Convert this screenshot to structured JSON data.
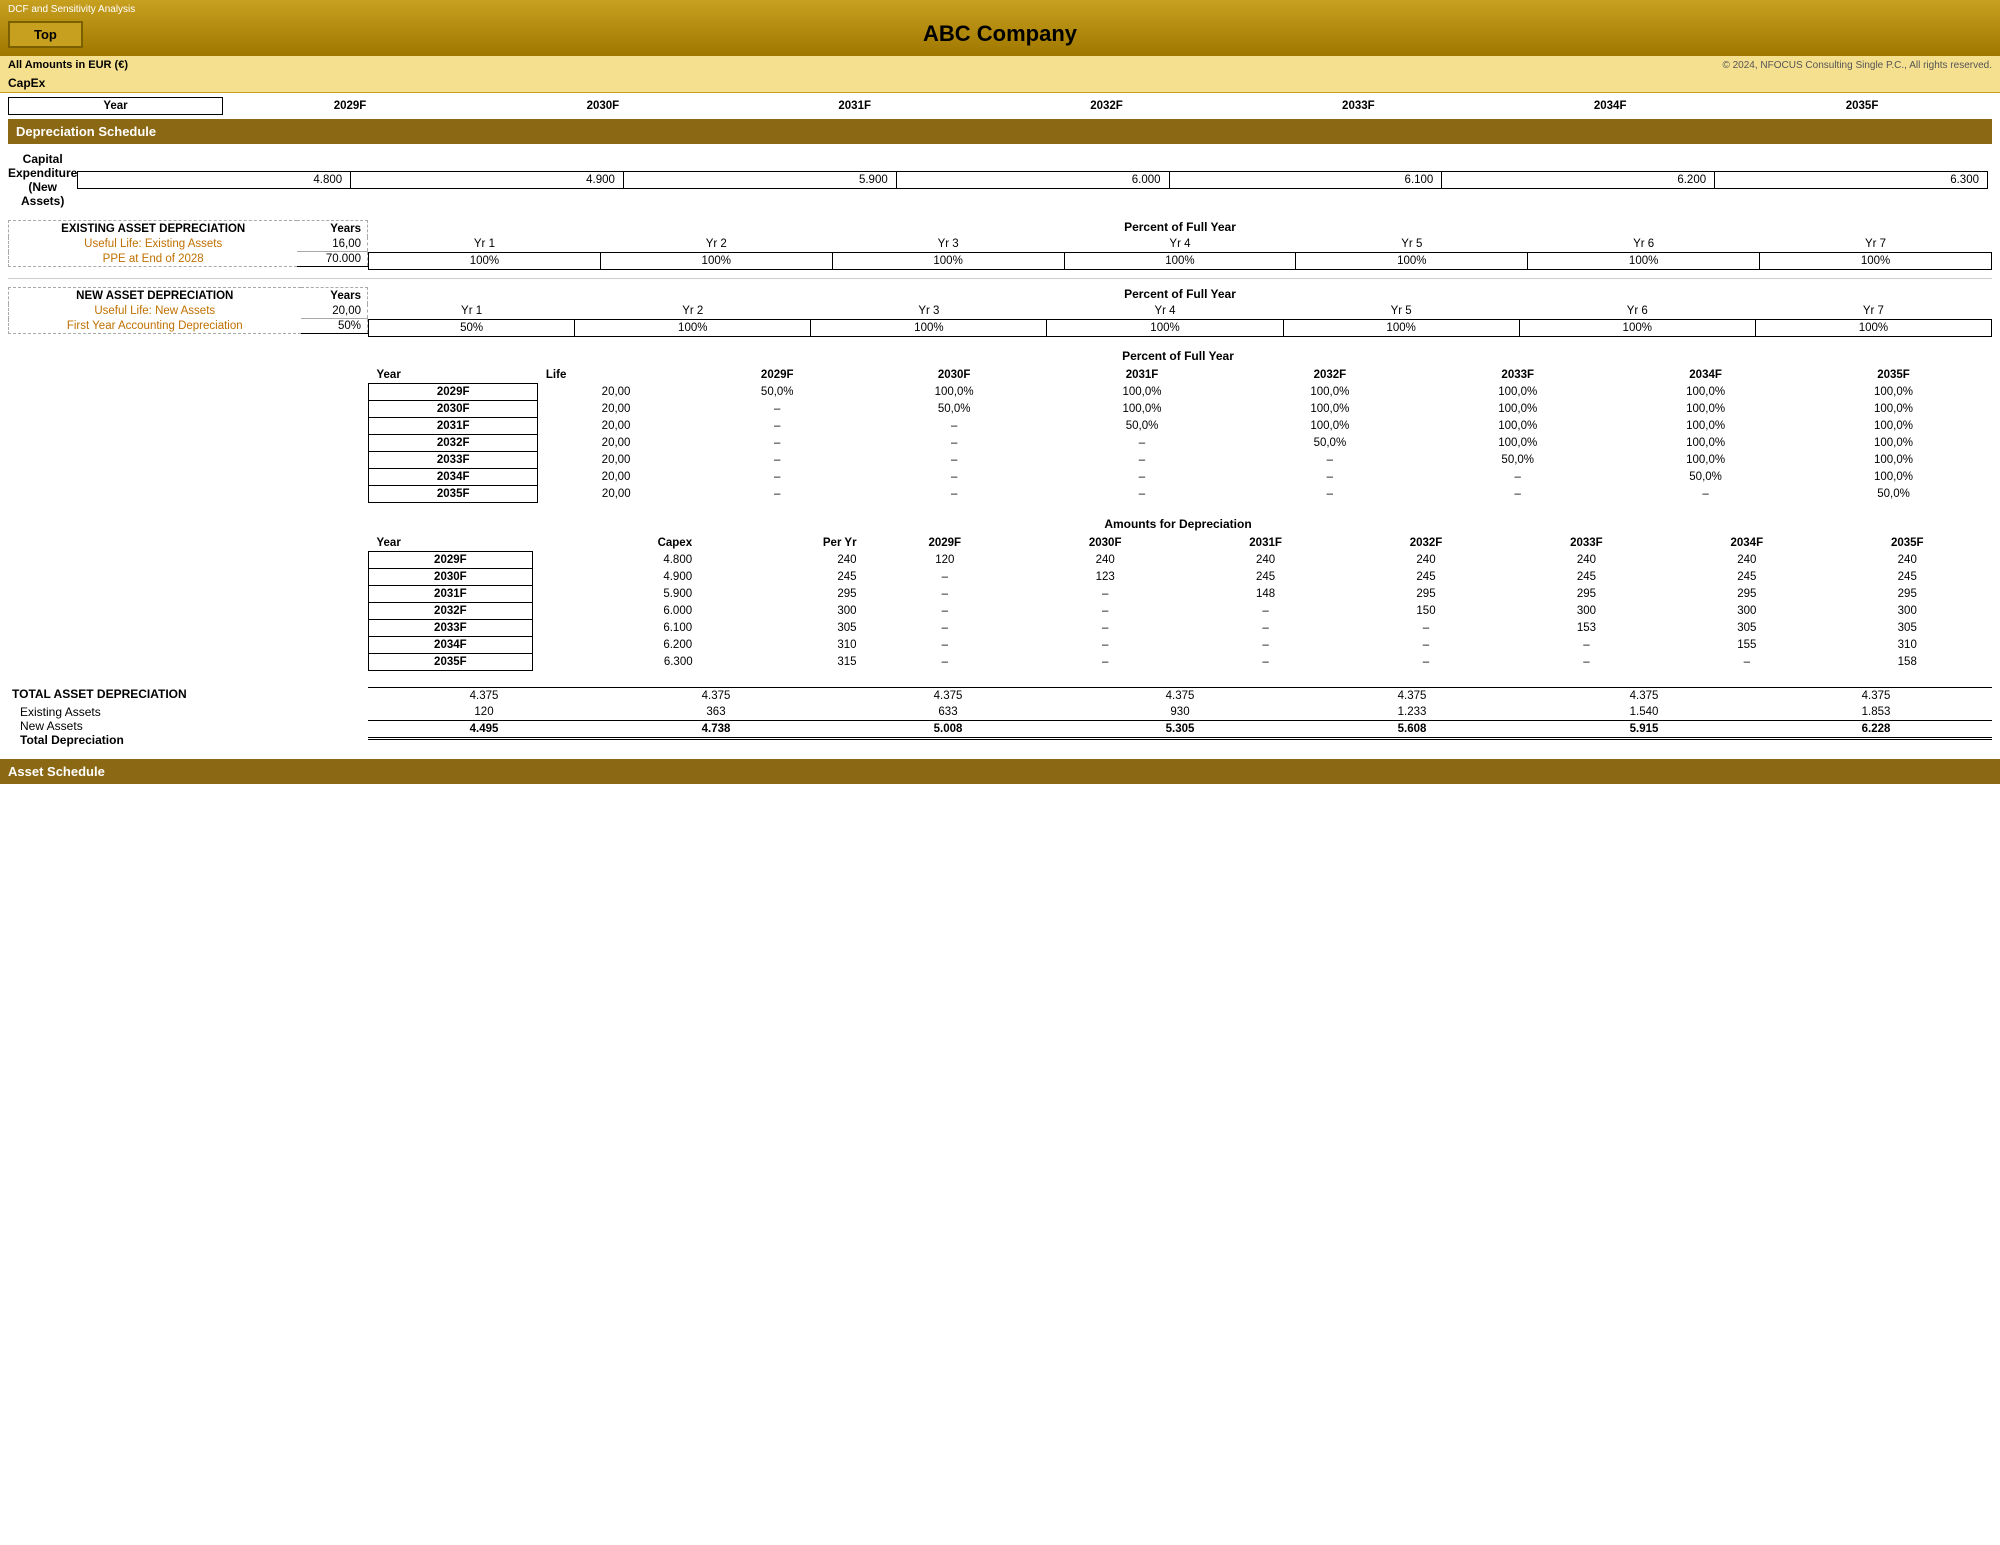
{
  "app": {
    "dcf_label": "DCF and Sensitivity Analysis",
    "title": "ABC Company",
    "top_button": "Top",
    "amounts_label": "All Amounts in  EUR (€)",
    "copyright": "© 2024, NFOCUS Consulting Single P.C., All rights reserved.",
    "capex_section": "CapEx"
  },
  "sections": {
    "depreciation_schedule": "Depreciation Schedule",
    "asset_schedule": "Asset Schedule"
  },
  "year_headers": [
    "Year",
    "2029F",
    "2030F",
    "2031F",
    "2032F",
    "2033F",
    "2034F",
    "2035F"
  ],
  "capital_expenditure": {
    "label": "Capital Expenditure  (New Assets)",
    "values": [
      "4.800",
      "4.900",
      "5.900",
      "6.000",
      "6.100",
      "6.200",
      "6.300"
    ]
  },
  "existing_asset": {
    "section_title": "EXISTING ASSET DEPRECIATION",
    "years_col": "Years",
    "rows": [
      {
        "label": "Useful Life: Existing Assets",
        "value": "16,00"
      },
      {
        "label": "PPE at End of 2028",
        "value": "70.000"
      }
    ],
    "pct_label": "Percent of Full Year",
    "yr_headers": [
      "Yr 1",
      "Yr 2",
      "Yr 3",
      "Yr 4",
      "Yr 5",
      "Yr 6",
      "Yr 7"
    ],
    "yr_values": [
      "100%",
      "100%",
      "100%",
      "100%",
      "100%",
      "100%",
      "100%"
    ]
  },
  "new_asset": {
    "section_title": "NEW ASSET DEPRECIATION",
    "years_col": "Years",
    "rows": [
      {
        "label": "Useful Life: New Assets",
        "value": "20,00"
      },
      {
        "label": "First Year Accounting Depreciation",
        "value": "50%"
      }
    ],
    "pct_label": "Percent of Full Year",
    "yr_headers": [
      "Yr 1",
      "Yr 2",
      "Yr 3",
      "Yr 4",
      "Yr 5",
      "Yr 6",
      "Yr 7"
    ],
    "yr_values": [
      "50%",
      "100%",
      "100%",
      "100%",
      "100%",
      "100%",
      "100%"
    ]
  },
  "pct_full_year_table": {
    "title": "Percent of Full Year",
    "col_headers": [
      "Year",
      "Life",
      "2029F",
      "2030F",
      "2031F",
      "2032F",
      "2033F",
      "2034F",
      "2035F"
    ],
    "rows": [
      {
        "year": "2029F",
        "life": "20,00",
        "vals": [
          "50,0%",
          "100,0%",
          "100,0%",
          "100,0%",
          "100,0%",
          "100,0%",
          "100,0%"
        ]
      },
      {
        "year": "2030F",
        "life": "20,00",
        "vals": [
          "–",
          "50,0%",
          "100,0%",
          "100,0%",
          "100,0%",
          "100,0%",
          "100,0%"
        ]
      },
      {
        "year": "2031F",
        "life": "20,00",
        "vals": [
          "–",
          "–",
          "50,0%",
          "100,0%",
          "100,0%",
          "100,0%",
          "100,0%"
        ]
      },
      {
        "year": "2032F",
        "life": "20,00",
        "vals": [
          "–",
          "–",
          "–",
          "50,0%",
          "100,0%",
          "100,0%",
          "100,0%"
        ]
      },
      {
        "year": "2033F",
        "life": "20,00",
        "vals": [
          "–",
          "–",
          "–",
          "–",
          "50,0%",
          "100,0%",
          "100,0%"
        ]
      },
      {
        "year": "2034F",
        "life": "20,00",
        "vals": [
          "–",
          "–",
          "–",
          "–",
          "–",
          "50,0%",
          "100,0%"
        ]
      },
      {
        "year": "2035F",
        "life": "20,00",
        "vals": [
          "–",
          "–",
          "–",
          "–",
          "–",
          "–",
          "50,0%"
        ]
      }
    ]
  },
  "amounts_depreciation_table": {
    "title": "Amounts for Depreciation",
    "col_headers": [
      "Year",
      "Capex",
      "Per Yr",
      "2029F",
      "2030F",
      "2031F",
      "2032F",
      "2033F",
      "2034F",
      "2035F"
    ],
    "rows": [
      {
        "year": "2029F",
        "capex": "4.800",
        "per_yr": "240",
        "vals": [
          "120",
          "240",
          "240",
          "240",
          "240",
          "240",
          "240"
        ]
      },
      {
        "year": "2030F",
        "capex": "4.900",
        "per_yr": "245",
        "vals": [
          "–",
          "123",
          "245",
          "245",
          "245",
          "245",
          "245"
        ]
      },
      {
        "year": "2031F",
        "capex": "5.900",
        "per_yr": "295",
        "vals": [
          "–",
          "–",
          "148",
          "295",
          "295",
          "295",
          "295"
        ]
      },
      {
        "year": "2032F",
        "capex": "6.000",
        "per_yr": "300",
        "vals": [
          "–",
          "–",
          "–",
          "150",
          "300",
          "300",
          "300"
        ]
      },
      {
        "year": "2033F",
        "capex": "6.100",
        "per_yr": "305",
        "vals": [
          "–",
          "–",
          "–",
          "–",
          "153",
          "305",
          "305"
        ]
      },
      {
        "year": "2034F",
        "capex": "6.200",
        "per_yr": "310",
        "vals": [
          "–",
          "–",
          "–",
          "–",
          "–",
          "155",
          "310"
        ]
      },
      {
        "year": "2035F",
        "capex": "6.300",
        "per_yr": "315",
        "vals": [
          "–",
          "–",
          "–",
          "–",
          "–",
          "–",
          "158"
        ]
      }
    ]
  },
  "total_asset_depreciation": {
    "title": "TOTAL ASSET DEPRECIATION",
    "rows": [
      {
        "label": "Existing Assets",
        "vals": [
          "4.375",
          "4.375",
          "4.375",
          "4.375",
          "4.375",
          "4.375",
          "4.375"
        ]
      },
      {
        "label": "New Assets",
        "vals": [
          "120",
          "363",
          "633",
          "930",
          "1.233",
          "1.540",
          "1.853"
        ]
      },
      {
        "label": "Total Depreciation",
        "vals": [
          "4.495",
          "4.738",
          "5.008",
          "5.305",
          "5.608",
          "5.915",
          "6.228"
        ]
      }
    ]
  }
}
